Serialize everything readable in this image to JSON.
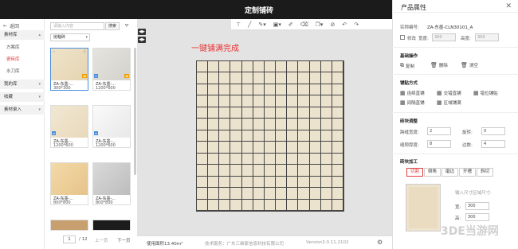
{
  "topbar": {
    "title": "定制铺砖",
    "close": "✕"
  },
  "leftnav": {
    "back": "返回",
    "groups": [
      {
        "label": "素材库"
      },
      {
        "label": "我的库"
      },
      {
        "label": "收藏"
      },
      {
        "label": "素材录入"
      }
    ],
    "items": [
      {
        "label": "方案库"
      },
      {
        "label": "瓷砖库"
      },
      {
        "label": "水刀库"
      }
    ]
  },
  "materials": {
    "search_placeholder": "请输入内容",
    "search_button": "搜索",
    "filter_select": "抛釉砖",
    "tiles": [
      {
        "name": "ZA-东墨-...",
        "size": "300*300"
      },
      {
        "name": "ZA-东墨-...",
        "size": "1200*600"
      },
      {
        "name": "ZA-东墨-...",
        "size": "1200*600"
      },
      {
        "name": "ZA-东墨-...",
        "size": "1200*600"
      },
      {
        "name": "ZA-东墨-...",
        "size": "800*800"
      },
      {
        "name": "ZA-东墨-...",
        "size": "800*800"
      }
    ],
    "pager": {
      "page": "1",
      "total": "/ 12",
      "prev": "上一页",
      "next": "下一页"
    }
  },
  "canvas": {
    "hint": "一键铺满完成",
    "side_buttons": [
      "◀▶",
      "◀▶"
    ],
    "grid": {
      "cols": 13,
      "rows": 13,
      "tile_color": "#ece3cf",
      "grout_color": "#444444"
    },
    "status": {
      "area": "使用面积13.40m²",
      "support": "技术服务：广东三维家信息科技有限公司",
      "version": "Version3.0.11.2102"
    }
  },
  "props": {
    "title": "产品属性",
    "name_label": "实称编号:",
    "name_value": "ZA-东墨-CLN30101_A",
    "modify_label": "修改",
    "width_label": "宽度:",
    "width_value": "300",
    "height_label": "高度:",
    "height_value": "300",
    "basic_ops_title": "基础操作",
    "basic_ops": [
      "复制",
      "删除",
      "清空"
    ],
    "layout_title": "铺贴方式",
    "layouts": [
      "连续直铺",
      "交错直铺",
      "错位铺贴",
      "间隔直铺",
      "区域铺满"
    ],
    "adjust_title": "砖块调整",
    "gap_h_label": "跨缝宽度:",
    "gap_h_value": "2",
    "rotate_label": "旋转:",
    "rotate_value": "0",
    "gap_v_label": "缝隙厚度:",
    "gap_v_value": "8",
    "count_label": "边数:",
    "count_value": "4",
    "process_title": "砖块加工",
    "tabs": [
      "切割",
      "倒角",
      "磨边",
      "开槽",
      "斜切"
    ],
    "size_hint": "输入尺寸区域尺寸:",
    "w_label": "宽:",
    "w_value": "300",
    "h_label": "高:",
    "h_value": "300"
  },
  "watermark": "3DE当游网"
}
